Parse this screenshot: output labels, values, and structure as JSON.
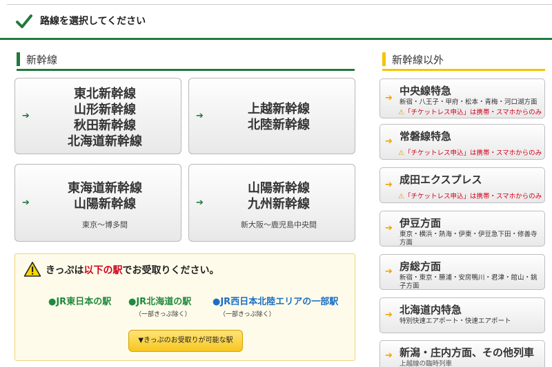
{
  "header": {
    "title": "路線を選択してください"
  },
  "sections": {
    "shinkansen": "新幹線",
    "other": "新幹線以外"
  },
  "shinkansen_buttons": [
    {
      "lines": [
        "東北新幹線",
        "山形新幹線",
        "秋田新幹線",
        "北海道新幹線"
      ],
      "sub": ""
    },
    {
      "lines": [
        "上越新幹線",
        "北陸新幹線"
      ],
      "sub": ""
    },
    {
      "lines": [
        "東海道新幹線",
        "山陽新幹線"
      ],
      "sub": "東京～博多間"
    },
    {
      "lines": [
        "山陽新幹線",
        "九州新幹線"
      ],
      "sub": "新大阪～鹿児島中央間"
    }
  ],
  "notice": {
    "msg_a": "きっぷは",
    "msg_b": "以下の駅",
    "msg_c": "でお受取りください。",
    "stations": [
      {
        "name": "●JR東日本の駅",
        "note": ""
      },
      {
        "name": "●JR北海道の駅",
        "note": "（一部きっぷ除く）"
      },
      {
        "name": "●JR西日本北陸エリアの一部駅",
        "note": "（一部きっぷ除く）"
      }
    ],
    "button": "▼きっぷのお受取りが可能な駅"
  },
  "ticketless_note": "「チケットレス申込」は携帯・スマホからのみ",
  "other_buttons": [
    {
      "name": "中央線特急",
      "desc": "新宿・八王子・甲府・松本・青梅・河口湖方面"
    },
    {
      "name": "常磐線特急",
      "desc": ""
    },
    {
      "name": "成田エクスプレス",
      "desc": ""
    },
    {
      "name": "伊豆方面",
      "desc": "東京・横浜・熱海・伊東・伊豆急下田・修善寺方面"
    },
    {
      "name": "房総方面",
      "desc": "新宿・東京・勝浦・安房鴨川・君津・館山・銚子方面"
    },
    {
      "name": "北海道内特急",
      "desc": "特別快速エアポート・快速エアポート"
    },
    {
      "name": "新潟・庄内方面、その他列車",
      "desc": "上越線の臨時列車"
    }
  ]
}
